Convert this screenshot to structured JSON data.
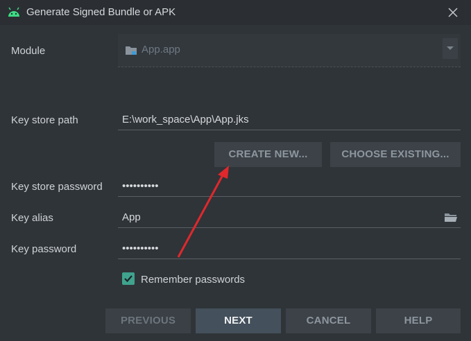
{
  "window": {
    "title": "Generate Signed Bundle or APK",
    "app_icon": "android-icon",
    "close_icon": "close-icon"
  },
  "form": {
    "module": {
      "label": "Module",
      "value": "App.app",
      "icon": "folder-icon"
    },
    "key_store_path": {
      "label": "Key store path",
      "value": "E:\\work_space\\App\\App.jks"
    },
    "create_new": "CREATE NEW...",
    "choose_existing": "CHOOSE EXISTING...",
    "key_store_password": {
      "label": "Key store password",
      "value": "••••••••••"
    },
    "key_alias": {
      "label": "Key alias",
      "value": "App",
      "icon": "folder-open-icon"
    },
    "key_password": {
      "label": "Key password",
      "value": "••••••••••"
    },
    "remember": {
      "label": "Remember passwords",
      "checked": true
    }
  },
  "footer": {
    "previous": "PREVIOUS",
    "next": "NEXT",
    "cancel": "CANCEL",
    "help": "HELP"
  },
  "colors": {
    "background": "#2f3438",
    "accent_check": "#3fa38e",
    "annotation_arrow": "#e0282c"
  }
}
